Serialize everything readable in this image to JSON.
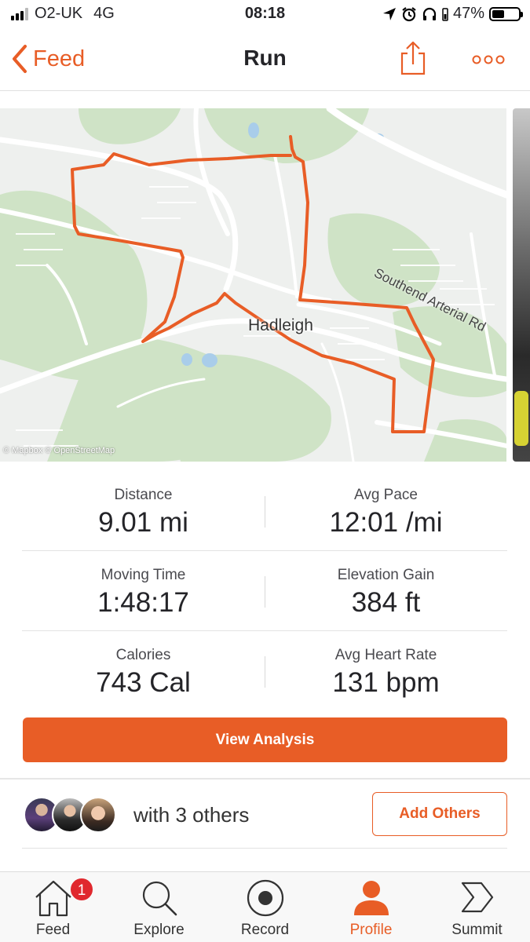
{
  "status_bar": {
    "carrier": "O2-UK",
    "network": "4G",
    "time": "08:18",
    "battery_percent": "47%",
    "battery_level": 0.47
  },
  "nav": {
    "back_label": "Feed",
    "title": "Run",
    "share_icon": "share-icon",
    "more_icon": "more-icon"
  },
  "map": {
    "town_label": "Hadleigh",
    "road_label": "Southend Arterial Rd",
    "attribution": "© Mapbox © OpenStreetMap",
    "route_color": "#e85d26"
  },
  "stats": [
    {
      "label": "Distance",
      "value": "9.01 mi"
    },
    {
      "label": "Avg Pace",
      "value": "12:01 /mi"
    },
    {
      "label": "Moving Time",
      "value": "1:48:17"
    },
    {
      "label": "Elevation Gain",
      "value": "384 ft"
    },
    {
      "label": "Calories",
      "value": "743 Cal"
    },
    {
      "label": "Avg Heart Rate",
      "value": "131 bpm"
    }
  ],
  "actions": {
    "view_analysis": "View Analysis",
    "with_others": "with 3 others",
    "add_others": "Add Others"
  },
  "tabbar": {
    "items": [
      {
        "label": "Feed",
        "icon": "home-icon",
        "badge": "1"
      },
      {
        "label": "Explore",
        "icon": "search-icon"
      },
      {
        "label": "Record",
        "icon": "record-icon"
      },
      {
        "label": "Profile",
        "icon": "profile-icon",
        "active": true
      },
      {
        "label": "Summit",
        "icon": "summit-icon"
      }
    ]
  },
  "colors": {
    "accent": "#e85d26",
    "badge": "#e0282e"
  }
}
